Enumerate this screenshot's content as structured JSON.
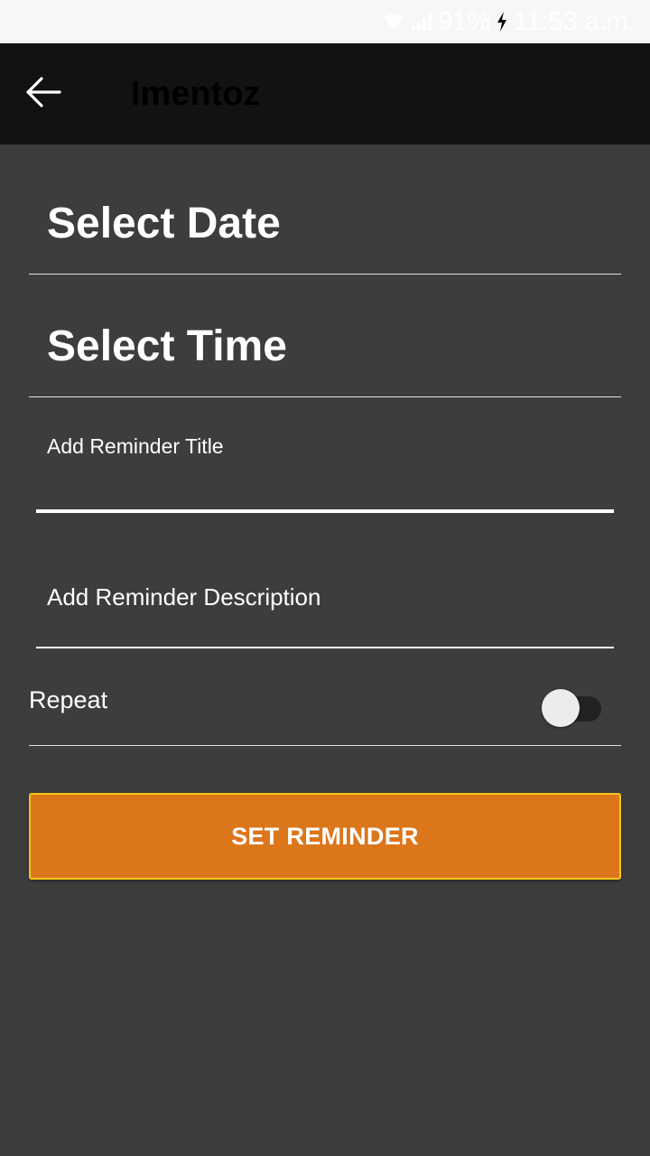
{
  "status_bar": {
    "battery": "91%",
    "time": "11:53 a.m.",
    "icons": [
      "wifi-icon",
      "signal-icon",
      "battery-charging-icon"
    ]
  },
  "app_bar": {
    "title": "Imentoz",
    "back_icon": "arrow-left-icon"
  },
  "form": {
    "select_date_label": "Select Date",
    "select_time_label": "Select Time",
    "title_field": {
      "placeholder": "Add Reminder Title",
      "value": ""
    },
    "description_field": {
      "placeholder": "Add Reminder Description",
      "value": ""
    },
    "repeat": {
      "label": "Repeat",
      "enabled": false
    },
    "submit_label": "SET REMINDER"
  },
  "colors": {
    "background": "#3d3d3d",
    "app_bar": "#121212",
    "accent": "#dc761b",
    "button_border": "#f5c518",
    "status_bar": "#f7f7f7"
  }
}
